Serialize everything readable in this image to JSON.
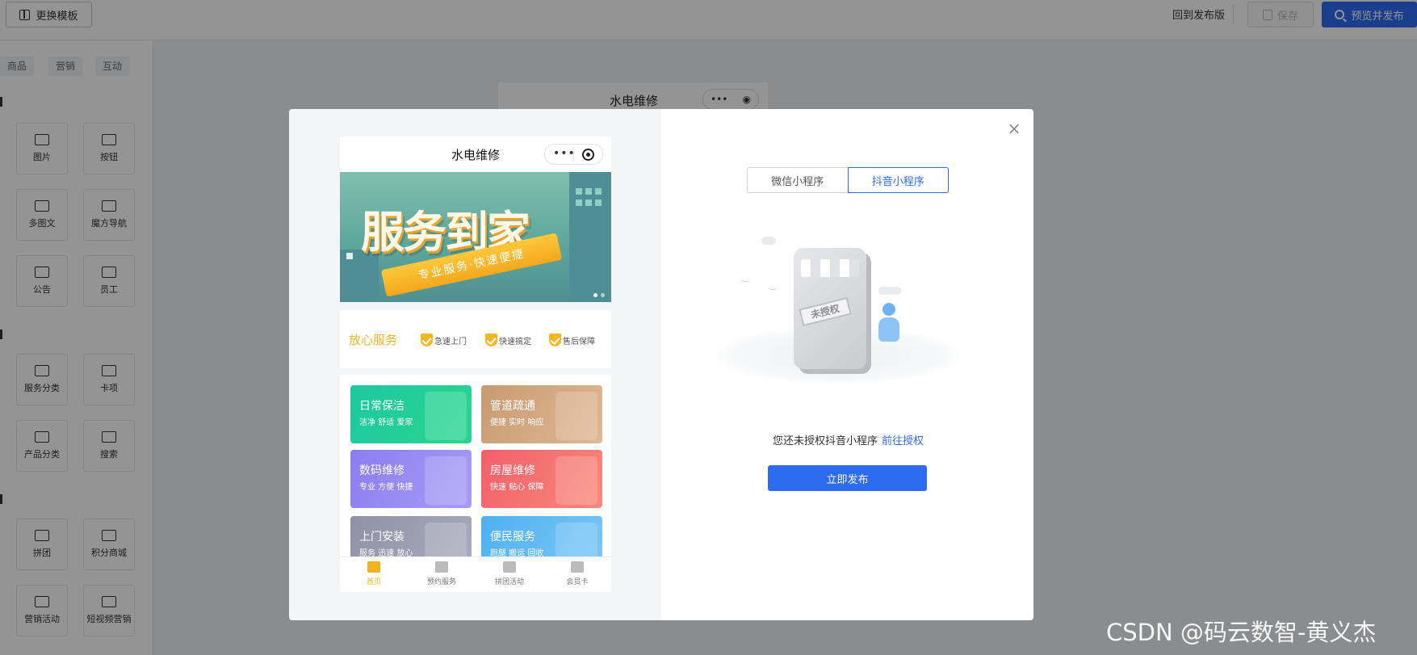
{
  "topbar": {
    "template_btn": "更换模板",
    "back_link": "回到发布版",
    "save_btn": "保存",
    "publish_btn": "预览并发布"
  },
  "left_panel": {
    "category_tabs": [
      "商品",
      "营销",
      "互动"
    ],
    "tiles": [
      "图片",
      "按钮",
      "多图文",
      "魔方导航",
      "公告",
      "员工",
      "服务分类",
      "卡项",
      "产品分类",
      "搜索",
      "拼团",
      "积分商城",
      "营销活动",
      "短视频营销"
    ]
  },
  "canvas": {
    "title": "水电维修"
  },
  "modal": {
    "phone": {
      "title": "水电维修",
      "banner_title": "服务到家",
      "banner_ribbon": "专业服务·快速便捷",
      "trust_title": "放心服务",
      "trust_items": [
        "急速上门",
        "快速搞定",
        "售后保障"
      ],
      "cards": [
        {
          "title": "日常保洁",
          "sub": "洁净 舒适 爱家",
          "color": "#1fc8a0"
        },
        {
          "title": "管道疏通",
          "sub": "便捷 实时 响应",
          "color": "#d9a67a"
        },
        {
          "title": "数码维修",
          "sub": "专业 方便 快捷",
          "color": "#8c86f2"
        },
        {
          "title": "房屋维修",
          "sub": "快速 贴心 保障",
          "color": "#f46f6f"
        },
        {
          "title": "上门安装",
          "sub": "服务 迅速 放心",
          "color": "#9a9db0"
        },
        {
          "title": "便民服务",
          "sub": "跑腿 搬运 回收",
          "color": "#5cb8f2"
        }
      ],
      "tabs": [
        "首页",
        "预约服务",
        "拼团活动",
        "会员卡"
      ]
    },
    "segment": [
      "微信小程序",
      "抖音小程序"
    ],
    "illustration_sign": "未授权",
    "auth_text": "您还未授权抖音小程序",
    "auth_link": "前往授权",
    "publish_now": "立即发布",
    "close_icon": "×"
  },
  "watermark": "CSDN @码云数智-黄义杰"
}
